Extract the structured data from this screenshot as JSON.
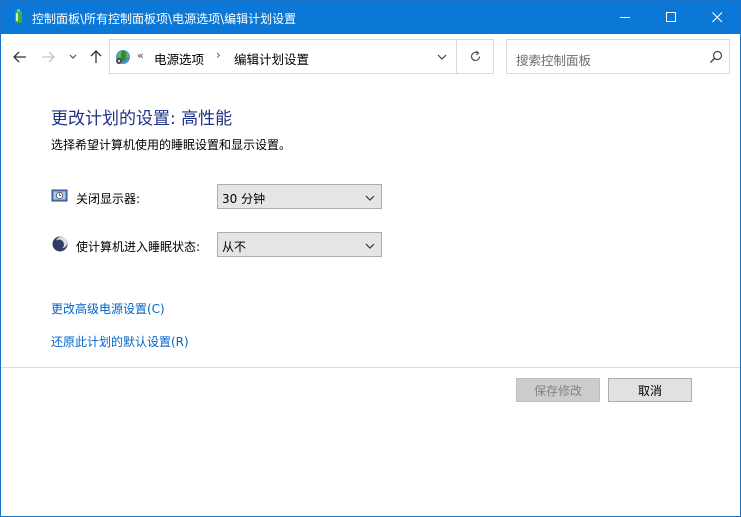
{
  "window": {
    "title": "控制面板\\所有控制面板项\\电源选项\\编辑计划设置"
  },
  "nav": {
    "address": {
      "chevron": "«",
      "crumbs": [
        "电源选项",
        "编辑计划设置"
      ],
      "separator": "›"
    },
    "search_placeholder": "搜索控制面板"
  },
  "content": {
    "heading": "更改计划的设置: 高性能",
    "subtext": "选择希望计算机使用的睡眠设置和显示设置。",
    "display_off": {
      "label": "关闭显示器:",
      "value": "30 分钟"
    },
    "sleep": {
      "label": "使计算机进入睡眠状态:",
      "value": "从不"
    },
    "links": {
      "advanced": "更改高级电源设置(C)",
      "restore": "还原此计划的默认设置(R)"
    }
  },
  "buttons": {
    "save": "保存修改",
    "cancel": "取消"
  },
  "colors": {
    "titlebar": "#0b78d7",
    "heading": "#1e3287",
    "link": "#0066cc"
  }
}
